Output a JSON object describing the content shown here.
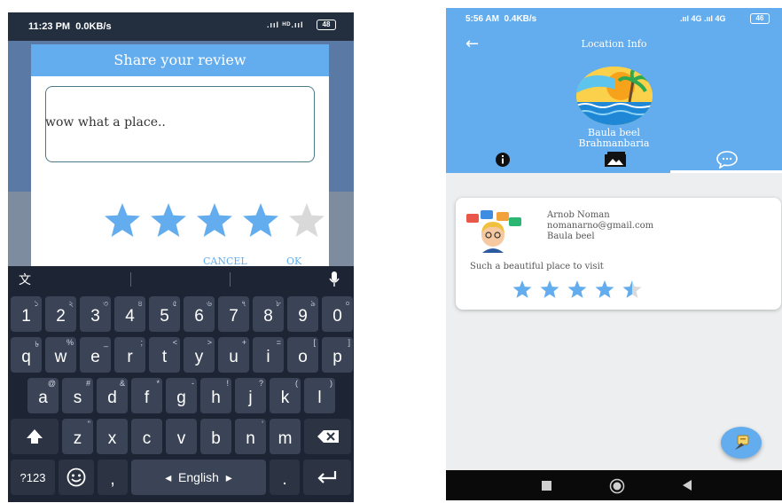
{
  "left_phone": {
    "status": {
      "time": "11:23 PM",
      "speed": "0.0KB/s",
      "signal": ".ııl ᴴᴰ.ııl",
      "battery": "48"
    },
    "dialog": {
      "title": "Share your review",
      "review_text": "wow what a place..",
      "rating": 4,
      "rating_max": 5,
      "cancel_label": "CANCEL",
      "ok_label": "OK"
    },
    "keyboard": {
      "row_numbers": [
        {
          "k": "1",
          "s": "১"
        },
        {
          "k": "2",
          "s": "২"
        },
        {
          "k": "3",
          "s": "৩"
        },
        {
          "k": "4",
          "s": "৪"
        },
        {
          "k": "5",
          "s": "৫"
        },
        {
          "k": "6",
          "s": "৬"
        },
        {
          "k": "7",
          "s": "৭"
        },
        {
          "k": "8",
          "s": "৮"
        },
        {
          "k": "9",
          "s": "৯"
        },
        {
          "k": "0",
          "s": "০"
        }
      ],
      "row_q": [
        {
          "k": "q",
          "s": "৳"
        },
        {
          "k": "w",
          "s": "%"
        },
        {
          "k": "e",
          "s": "_"
        },
        {
          "k": "r",
          "s": ";"
        },
        {
          "k": "t",
          "s": "<"
        },
        {
          "k": "y",
          "s": ">"
        },
        {
          "k": "u",
          "s": "+"
        },
        {
          "k": "i",
          "s": "="
        },
        {
          "k": "o",
          "s": "["
        },
        {
          "k": "p",
          "s": "]"
        }
      ],
      "row_a": [
        {
          "k": "a",
          "s": "@"
        },
        {
          "k": "s",
          "s": "#"
        },
        {
          "k": "d",
          "s": "&"
        },
        {
          "k": "f",
          "s": "*"
        },
        {
          "k": "g",
          "s": "-"
        },
        {
          "k": "h",
          "s": "!"
        },
        {
          "k": "j",
          "s": "?"
        },
        {
          "k": "k",
          "s": "("
        },
        {
          "k": "l",
          "s": ")"
        }
      ],
      "row_z": [
        {
          "k": "z",
          "s": "\""
        },
        {
          "k": "x",
          "s": ""
        },
        {
          "k": "c",
          "s": ""
        },
        {
          "k": "v",
          "s": ""
        },
        {
          "k": "b",
          "s": ""
        },
        {
          "k": "n",
          "s": "'"
        },
        {
          "k": "m",
          "s": ""
        }
      ],
      "symbols_label": "?123",
      "comma_label": ",",
      "space_label": "English",
      "period_label": "."
    }
  },
  "right_phone": {
    "status": {
      "time": "5:56 AM",
      "speed": "0.4KB/s",
      "signal": ".ııl 4G .ııl 4G",
      "battery": "46"
    },
    "title": "Location Info",
    "place_name": "Baula beel",
    "place_district": "Brahmanbaria",
    "review": {
      "author": "Arnob Noman",
      "email": "nomanarno@gmail.com",
      "place": "Baula beel",
      "comment": "Such a beautiful place to visit",
      "rating": 4.5,
      "rating_max": 5
    },
    "colors": {
      "accent": "#63adee",
      "star": "#63adee"
    },
    "icons": [
      "back-arrow-icon",
      "info-icon",
      "gallery-icon",
      "chat-icon",
      "add-review-icon"
    ]
  }
}
